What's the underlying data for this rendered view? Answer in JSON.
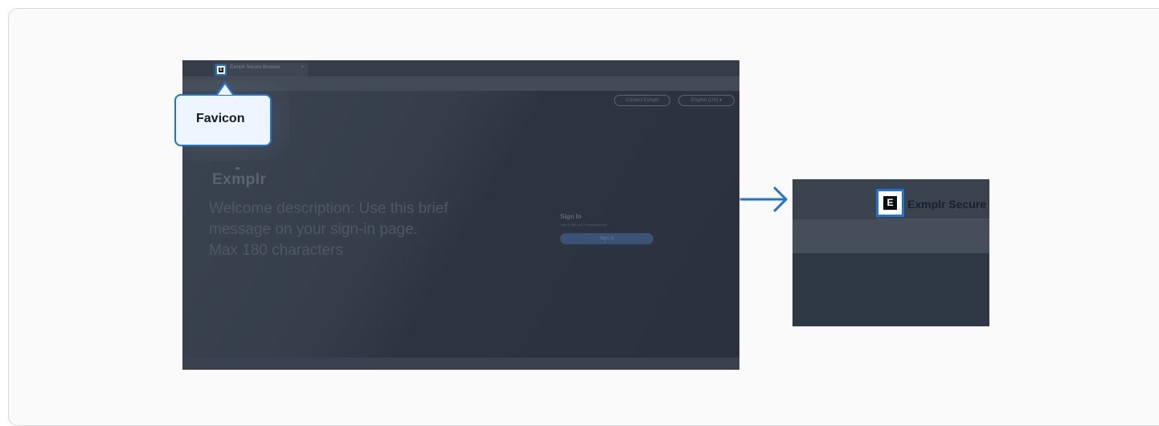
{
  "callout": {
    "label": "Favicon"
  },
  "favicon": {
    "letter": "E"
  },
  "main_screenshot": {
    "tab_label": "Exmplr Secure Browser",
    "tab_close": "×",
    "top_buttons": [
      "Contact Exmplr",
      "English (US)  ▾"
    ],
    "brand": "Exmplr",
    "welcome_text": "Welcome description: Use this brief message on your sign-in page. Max 180 characters",
    "signin_title": "Sign In",
    "signin_subtitle": "Sign in with your Exmplr account",
    "signin_button": "Sign in"
  },
  "zoom_screenshot": {
    "tab_label": "Exmplr Secure B"
  },
  "colors": {
    "accent": "#1f73d8",
    "background": "#fafafa",
    "screen_dark": "#2c3440"
  }
}
